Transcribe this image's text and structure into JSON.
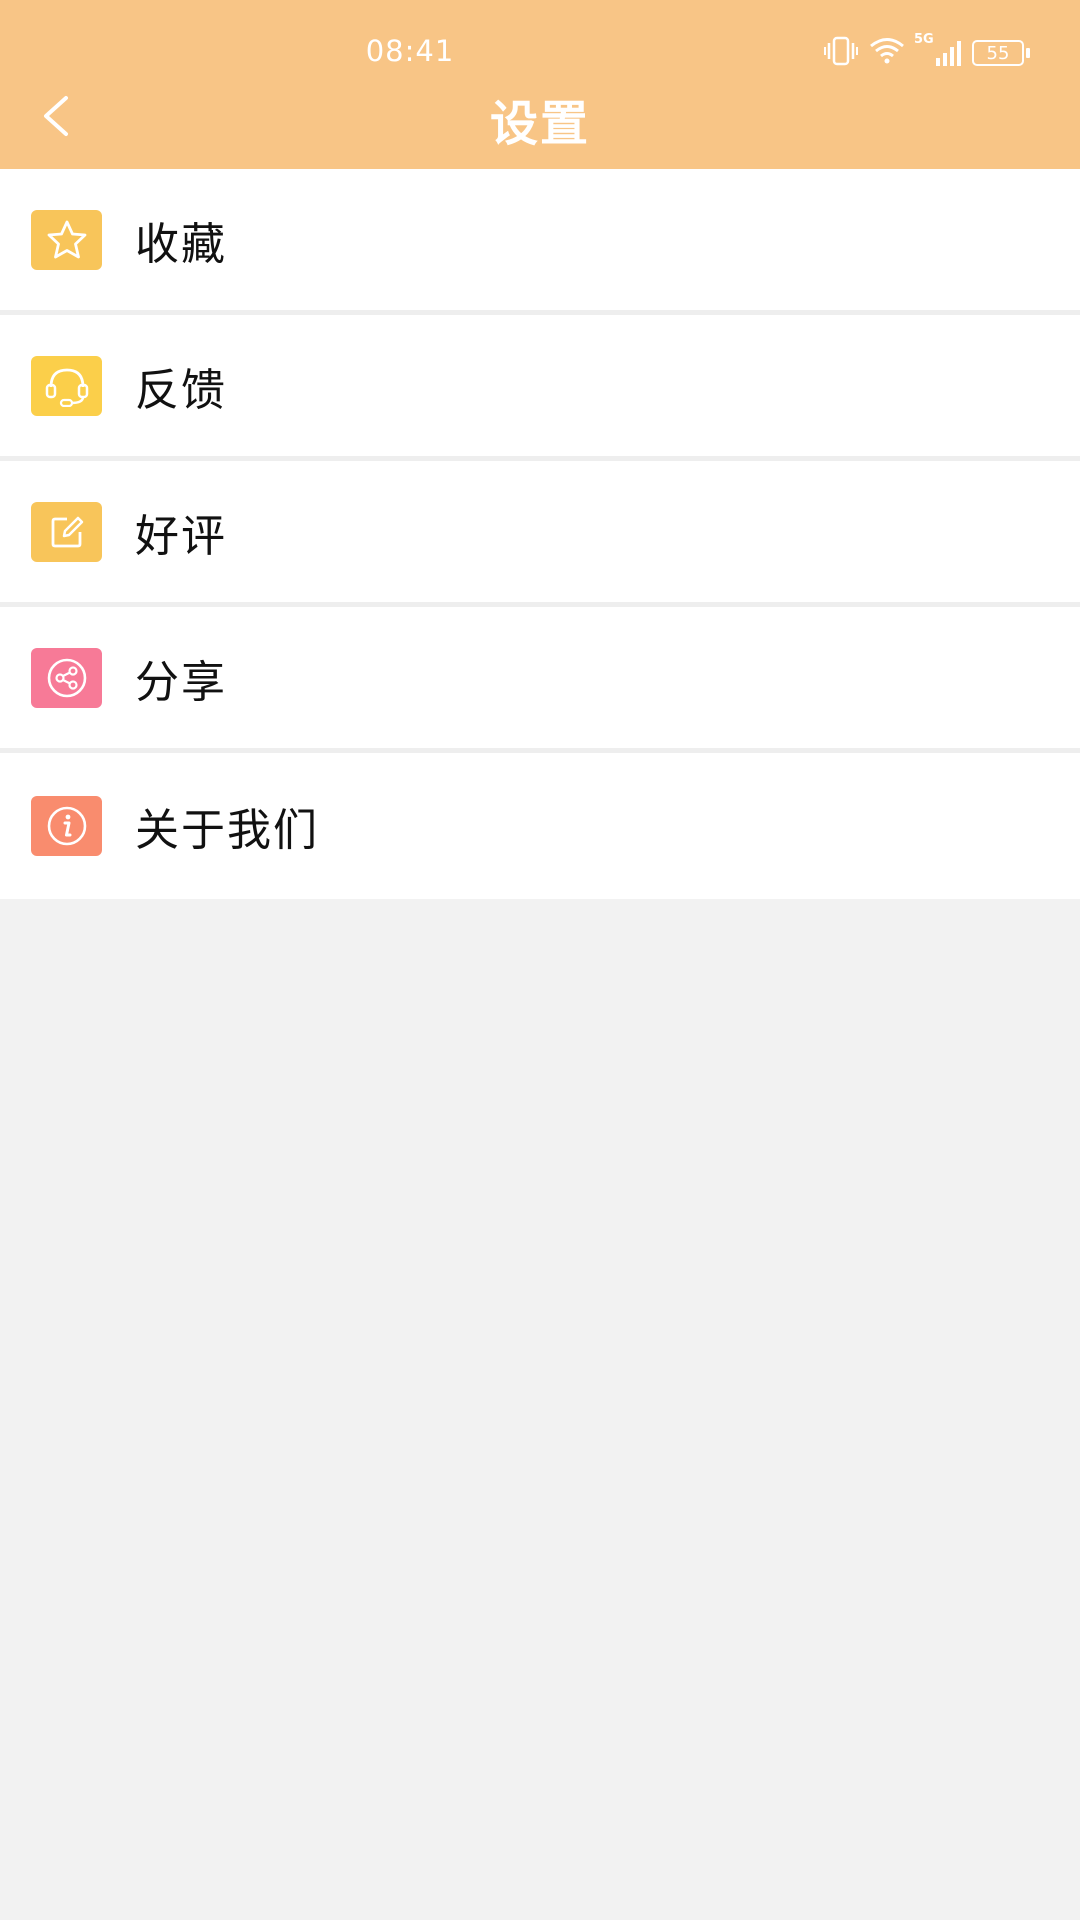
{
  "status_bar": {
    "time": "08:41",
    "network": "5G",
    "battery": "55",
    "icons": [
      "vibrate-icon",
      "wifi-icon",
      "signal-icon",
      "battery-icon"
    ]
  },
  "header": {
    "title": "设置",
    "back_icon": "chevron-left-icon",
    "background_color": "#f8c586"
  },
  "menu": {
    "items": [
      {
        "label": "收藏",
        "icon": "star-icon",
        "color": "#f8c55a"
      },
      {
        "label": "反馈",
        "icon": "headset-icon",
        "color": "#fbcf4a"
      },
      {
        "label": "好评",
        "icon": "edit-icon",
        "color": "#f8c55a"
      },
      {
        "label": "分享",
        "icon": "share-icon",
        "color": "#f77a97"
      },
      {
        "label": "关于我们",
        "icon": "info-icon",
        "color": "#f98c6e"
      }
    ]
  }
}
